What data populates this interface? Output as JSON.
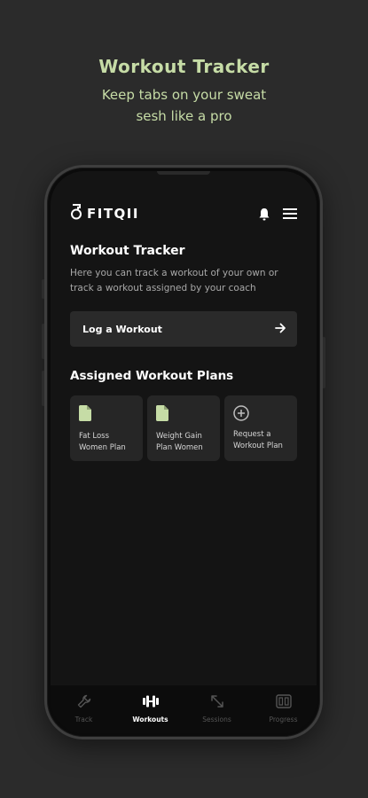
{
  "hero": {
    "title": "Workout Tracker",
    "subtitle_line1": "Keep tabs on your sweat",
    "subtitle_line2": "sesh like a pro"
  },
  "app": {
    "logo_text": "FITQII",
    "icons": [
      "bell-icon",
      "menu-icon"
    ]
  },
  "tracker": {
    "title": "Workout Tracker",
    "description": "Here you can track a workout of your own or track a workout assigned by your coach",
    "log_button_label": "Log a Workout"
  },
  "plans": {
    "title": "Assigned Workout Plans",
    "items": [
      {
        "line1": "Fat Loss",
        "line2": "Women Plan",
        "icon": "document-icon"
      },
      {
        "line1": "Weight Gain",
        "line2": "Plan Women",
        "icon": "document-icon"
      },
      {
        "line1": "Request a",
        "line2": "Workout Plan",
        "icon": "plus-circle-icon"
      }
    ]
  },
  "nav": {
    "items": [
      {
        "label": "Track",
        "icon": "wrench-icon",
        "active": false
      },
      {
        "label": "Workouts",
        "icon": "dumbbell-icon",
        "active": true
      },
      {
        "label": "Sessions",
        "icon": "expand-icon",
        "active": false
      },
      {
        "label": "Progress",
        "icon": "columns-icon",
        "active": false
      }
    ]
  },
  "colors": {
    "accent": "#c6dca6",
    "background": "#2b2b2b",
    "screen": "#141414",
    "card": "#262626"
  }
}
